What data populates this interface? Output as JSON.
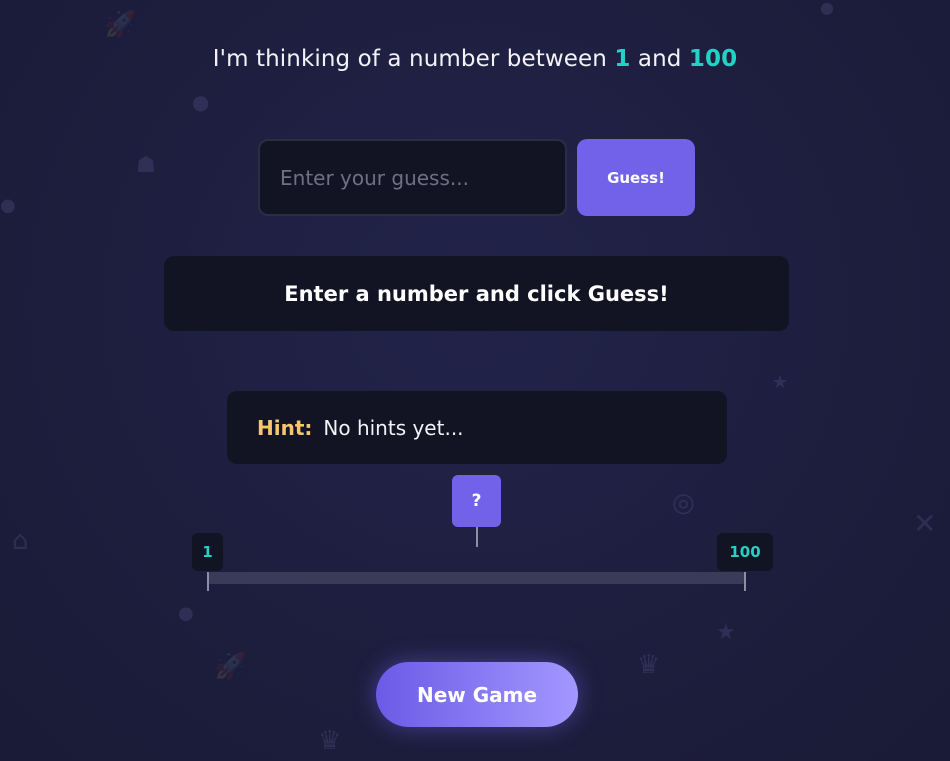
{
  "game": {
    "prompt_prefix": "I'm thinking of a number between",
    "range_min": "1",
    "prompt_and": "and",
    "range_max": "100"
  },
  "input": {
    "placeholder": "Enter your guess...",
    "value": ""
  },
  "buttons": {
    "guess": "Guess!",
    "new_game": "New Game"
  },
  "message": "Enter a number and click Guess!",
  "hint": {
    "label": "Hint:",
    "text": "No hints yet..."
  },
  "number_line": {
    "min_label": "1",
    "max_label": "100",
    "marker_label": "?",
    "marker_position_fraction": 0.5
  },
  "colors": {
    "accent": "#7262ea",
    "range_highlight": "#22d3c5",
    "hint_label": "#f6c66b",
    "background": "#1e1f3d"
  },
  "decorations": [
    "rocket-icon",
    "planet-icon",
    "robot-icon",
    "target-icon",
    "crown-icon",
    "star-icon",
    "close-icon",
    "alien-icon"
  ]
}
